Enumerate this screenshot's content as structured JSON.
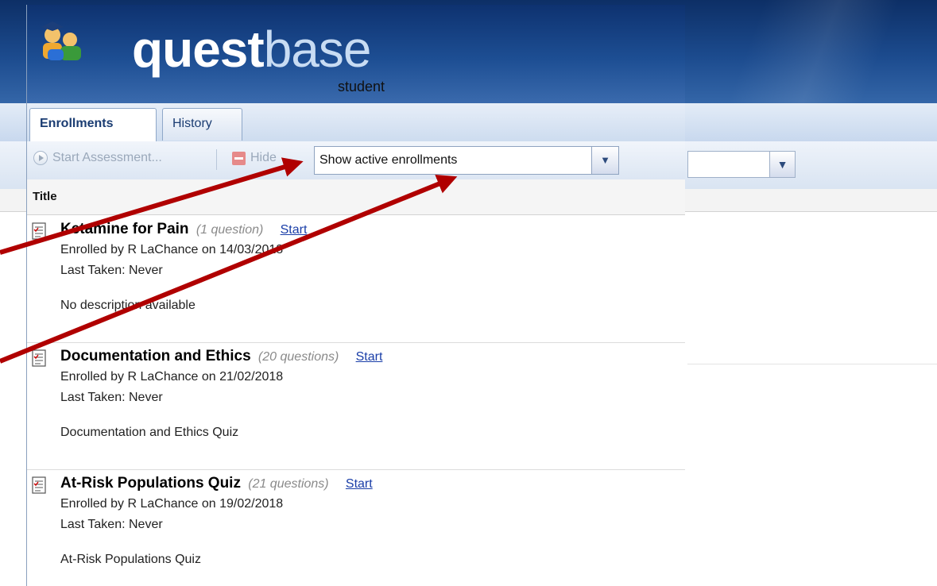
{
  "app": {
    "brand_main": "quest",
    "brand_accent": "base",
    "brand_sub": "student"
  },
  "tabs": [
    {
      "label": "Enrollments",
      "active": true
    },
    {
      "label": "History",
      "active": false
    }
  ],
  "toolbar": {
    "start_label": "Start Assessment...",
    "hide_label": "Hide",
    "filter_value": "Show active enrollments"
  },
  "list": {
    "column_title": "Title",
    "items": [
      {
        "title": "Ketamine for Pain",
        "count": "(1 question)",
        "start": "Start",
        "enrolled": "Enrolled by R LaChance on 14/03/2018",
        "last_taken": "Last Taken: Never",
        "description": "No description available"
      },
      {
        "title": "Documentation and Ethics",
        "count": "(20 questions)",
        "start": "Start",
        "enrolled": "Enrolled by R LaChance on 21/02/2018",
        "last_taken": "Last Taken: Never",
        "description": "Documentation and Ethics Quiz"
      },
      {
        "title": "At-Risk Populations Quiz",
        "count": "(21 questions)",
        "start": "Start",
        "enrolled": "Enrolled by R LaChance on 19/02/2018",
        "last_taken": "Last Taken: Never",
        "description": "At-Risk Populations Quiz"
      }
    ]
  },
  "colors": {
    "header_blue": "#1d4e93",
    "link_blue": "#1a3ea8",
    "arrow_red": "#b00000"
  }
}
